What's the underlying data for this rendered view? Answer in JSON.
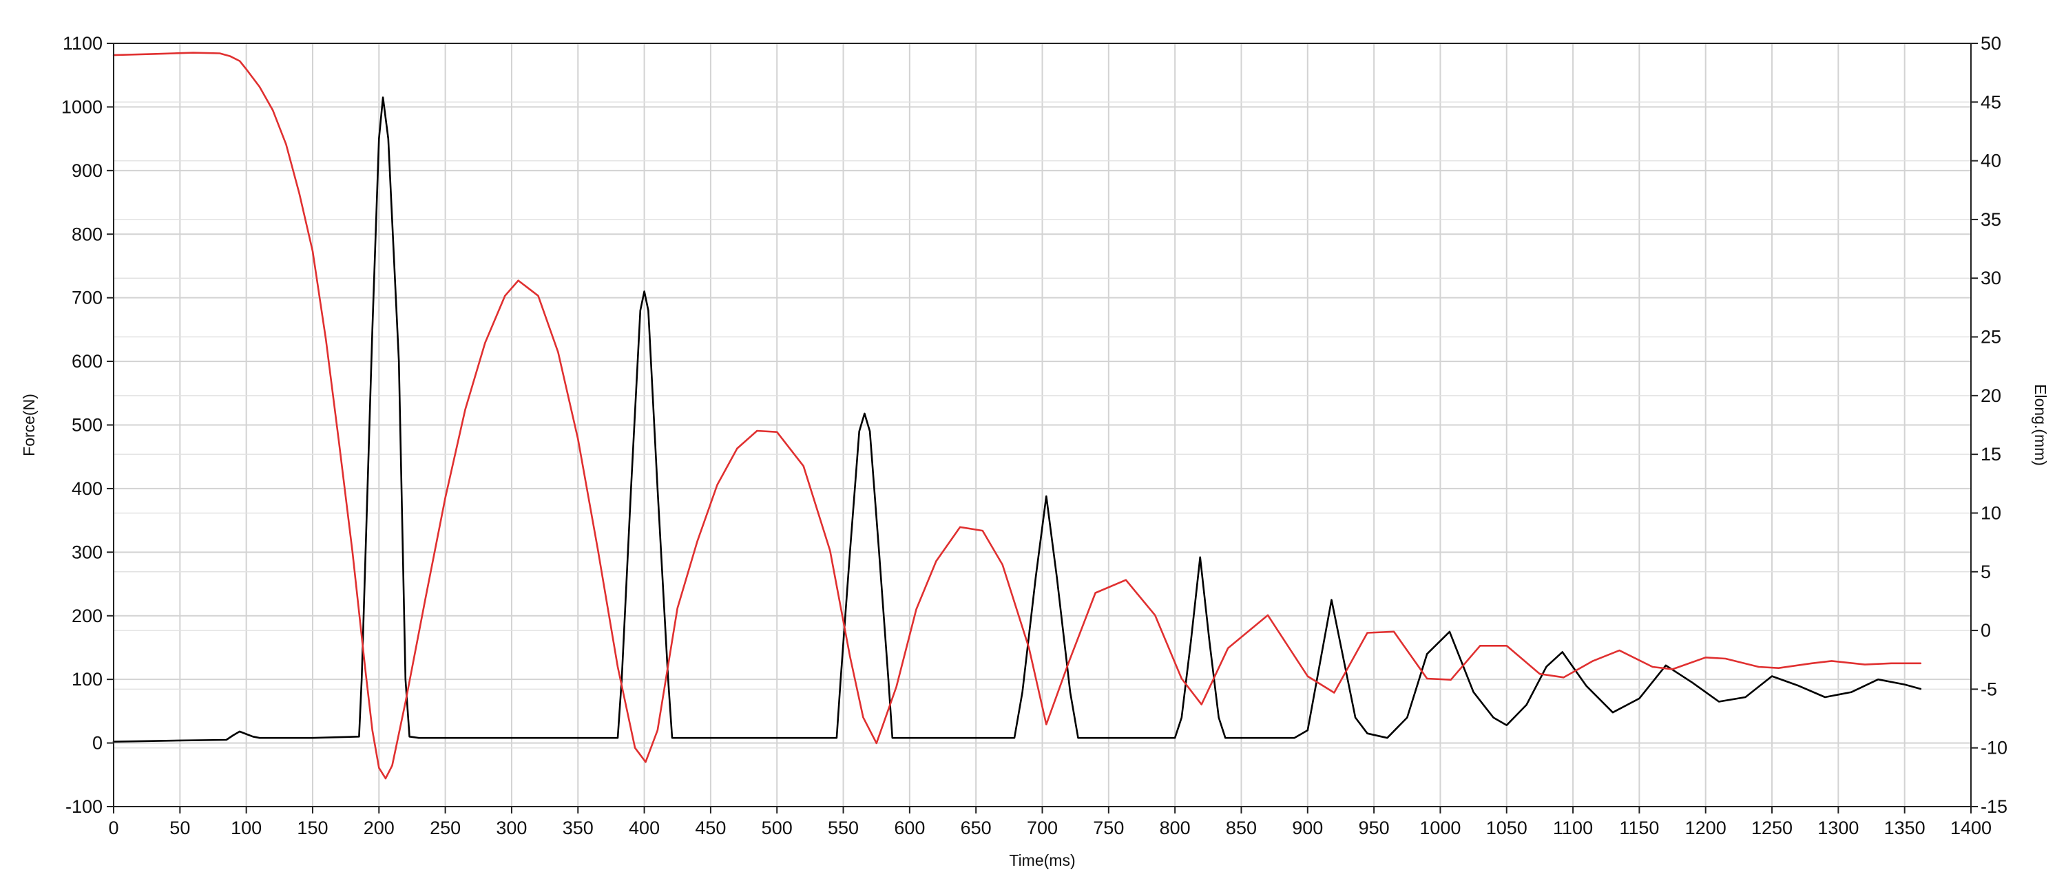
{
  "chart_data": {
    "type": "line",
    "title": "",
    "xlabel": "Time(ms)",
    "ylabel_left": "Force(N)",
    "ylabel_right": "Elong.(mm)",
    "xlim": [
      0,
      1400
    ],
    "ylim_left": [
      -100,
      1100
    ],
    "ylim_right": [
      -15,
      50
    ],
    "x_ticks": [
      0,
      50,
      100,
      150,
      200,
      250,
      300,
      350,
      400,
      450,
      500,
      550,
      600,
      650,
      700,
      750,
      800,
      850,
      900,
      950,
      1000,
      1050,
      1100,
      1150,
      1200,
      1250,
      1300,
      1350,
      1400
    ],
    "y_left_ticks": [
      -100,
      0,
      100,
      200,
      300,
      400,
      500,
      600,
      700,
      800,
      900,
      1000,
      1100
    ],
    "y_right_ticks": [
      -15,
      -10,
      -5,
      0,
      5,
      10,
      15,
      20,
      25,
      30,
      35,
      40,
      45,
      50
    ],
    "grid": true,
    "legend": "none",
    "series": [
      {
        "color": "#000000",
        "axis": "left",
        "x": [
          0,
          50,
          85,
          90,
          95,
          100,
          105,
          110,
          150,
          185,
          187,
          195,
          200,
          203,
          207,
          215,
          220,
          223,
          230,
          300,
          380,
          383,
          390,
          397,
          400,
          403,
          410,
          418,
          421,
          430,
          500,
          545,
          548,
          555,
          562,
          566,
          570,
          577,
          584,
          587,
          600,
          660,
          679,
          685,
          695,
          703,
          711,
          721,
          727,
          740,
          790,
          800,
          805,
          812,
          819,
          826,
          833,
          838,
          850,
          890,
          900,
          918,
          936,
          945,
          960,
          975,
          990,
          1007,
          1025,
          1040,
          1050,
          1065,
          1080,
          1092,
          1110,
          1130,
          1150,
          1170,
          1190,
          1210,
          1230,
          1250,
          1270,
          1290,
          1310,
          1330,
          1350,
          1362
        ],
        "values": [
          2,
          4,
          5,
          12,
          18,
          14,
          10,
          8,
          8,
          10,
          100,
          650,
          950,
          1015,
          950,
          600,
          100,
          10,
          8,
          8,
          8,
          100,
          400,
          680,
          710,
          680,
          400,
          100,
          8,
          8,
          8,
          8,
          100,
          300,
          490,
          518,
          490,
          300,
          100,
          8,
          8,
          8,
          8,
          80,
          260,
          388,
          260,
          80,
          8,
          8,
          8,
          8,
          40,
          160,
          292,
          160,
          40,
          8,
          8,
          8,
          20,
          225,
          40,
          15,
          8,
          40,
          140,
          175,
          80,
          40,
          28,
          60,
          120,
          143,
          90,
          48,
          70,
          122,
          95,
          65,
          72,
          105,
          90,
          72,
          80,
          100,
          92,
          85
        ]
      },
      {
        "color": "#e03030",
        "axis": "right",
        "x": [
          0,
          30,
          60,
          80,
          88,
          95,
          100,
          110,
          120,
          130,
          140,
          150,
          160,
          170,
          180,
          190,
          195,
          200,
          205,
          210,
          220,
          235,
          250,
          265,
          280,
          295,
          305,
          320,
          335,
          350,
          365,
          380,
          393,
          401,
          410,
          425,
          440,
          455,
          470,
          485,
          500,
          520,
          540,
          555,
          565,
          575,
          590,
          605,
          620,
          638,
          655,
          670,
          690,
          703,
          720,
          740,
          763,
          785,
          805,
          820,
          840,
          870,
          900,
          920,
          945,
          965,
          990,
          1008,
          1030,
          1050,
          1075,
          1093,
          1115,
          1135,
          1160,
          1175,
          1200,
          1215,
          1240,
          1255,
          1280,
          1295,
          1320,
          1340,
          1362
        ],
        "values": [
          49.0,
          49.1,
          49.2,
          49.15,
          48.9,
          48.5,
          47.8,
          46.3,
          44.3,
          41.4,
          37.2,
          32.3,
          24.8,
          15.9,
          6.7,
          -3.6,
          -8.5,
          -11.7,
          -12.6,
          -11.5,
          -6.1,
          2.7,
          11.3,
          18.8,
          24.5,
          28.5,
          29.8,
          28.5,
          23.7,
          16.3,
          6.9,
          -3.1,
          -10.0,
          -11.2,
          -8.5,
          1.9,
          7.6,
          12.4,
          15.5,
          17.0,
          16.9,
          14.0,
          6.8,
          -2.2,
          -7.4,
          -9.6,
          -4.8,
          1.8,
          5.9,
          8.8,
          8.5,
          5.6,
          -1.5,
          -8.0,
          -2.7,
          3.2,
          4.3,
          1.3,
          -4.1,
          -6.3,
          -1.5,
          1.3,
          -3.9,
          -5.3,
          -0.2,
          -0.1,
          -4.1,
          -4.2,
          -1.3,
          -1.3,
          -3.7,
          -4.0,
          -2.6,
          -1.7,
          -3.1,
          -3.3,
          -2.3,
          -2.4,
          -3.1,
          -3.2,
          -2.8,
          -2.6,
          -2.9,
          -2.8,
          -2.8
        ]
      }
    ]
  }
}
